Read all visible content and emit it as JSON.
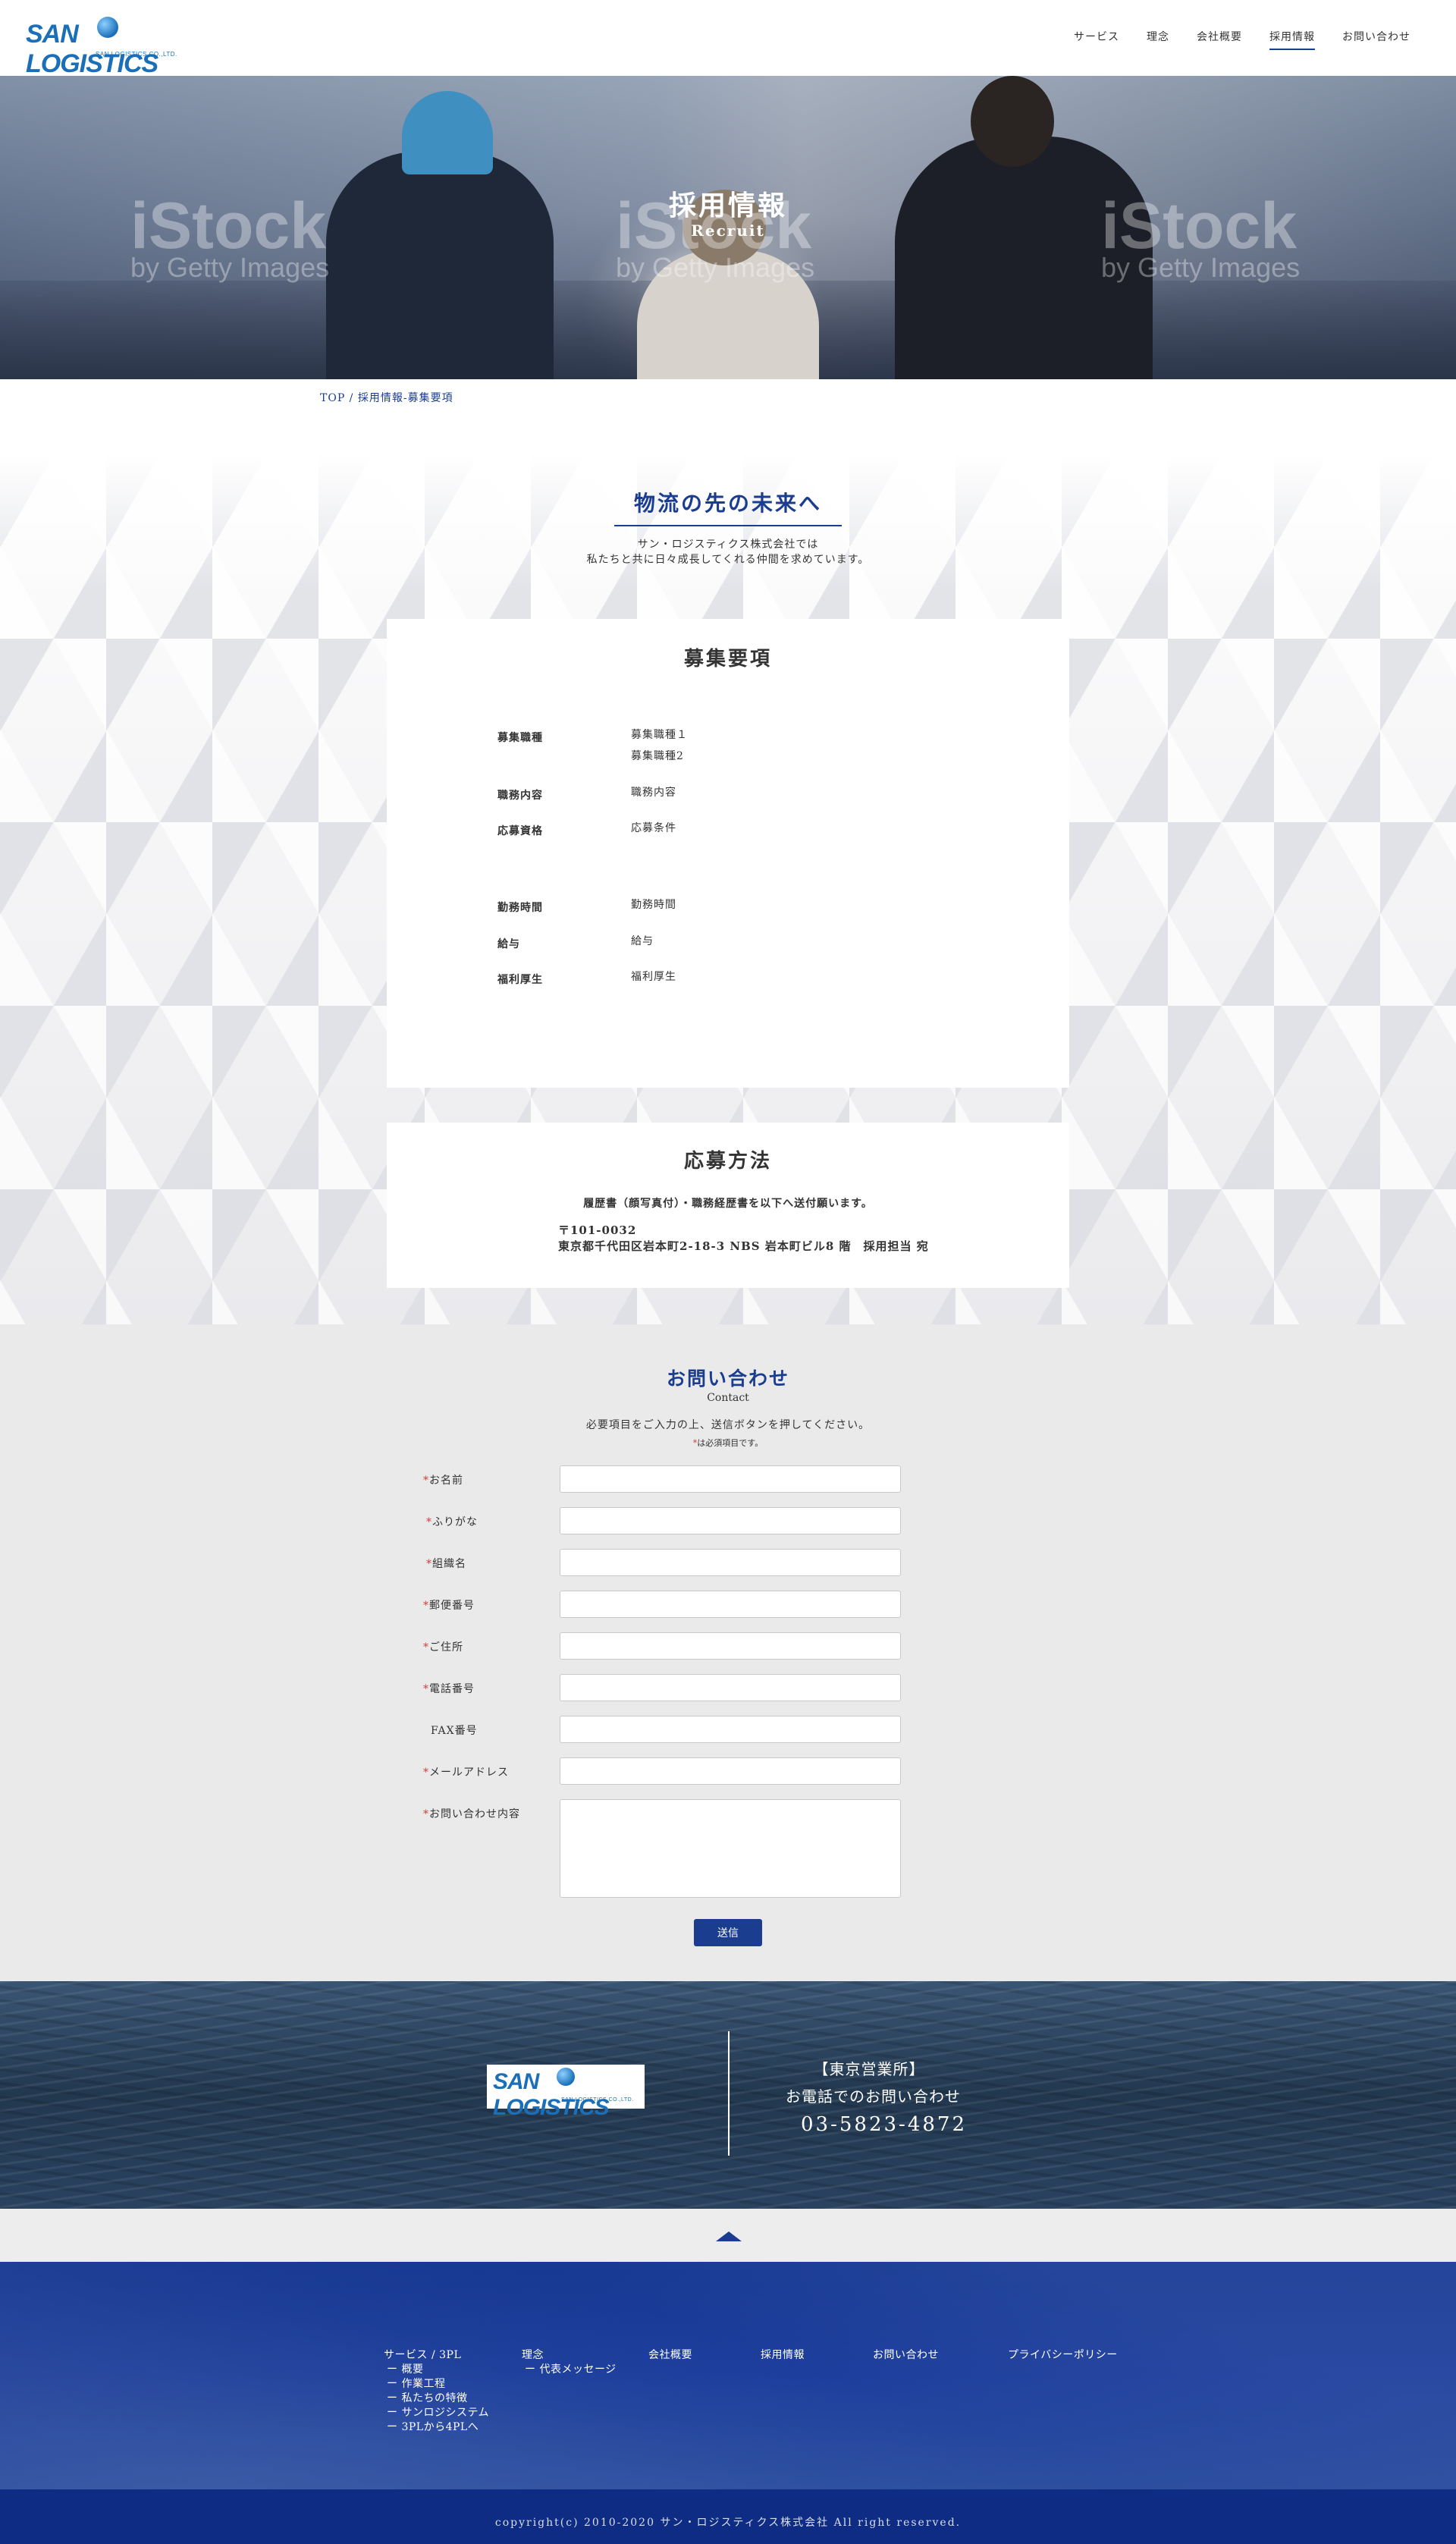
{
  "header": {
    "logo_text": "SAN LOGISTICS",
    "logo_sub": "SAN LOGISTICS CO.,LTD.",
    "nav": [
      {
        "label": "サービス"
      },
      {
        "label": "理念"
      },
      {
        "label": "会社概要"
      },
      {
        "label": "採用情報"
      },
      {
        "label": "お問い合わせ"
      }
    ]
  },
  "hero": {
    "title": "採用情報",
    "subtitle": "Recruit",
    "watermark_main": "iStock",
    "watermark_sub": "by Getty Images"
  },
  "breadcrumb": "TOP / 採用情報-募集要項",
  "lead": {
    "title": "物流の先の未来へ",
    "line1": "サン・ロジスティクス株式会社では",
    "line2": "私たちと共に日々成長してくれる仲間を求めています。"
  },
  "requirements": {
    "title": "募集要項",
    "rows": [
      {
        "label": "募集職種",
        "value": "募集職種１",
        "value2": "募集職種2"
      },
      {
        "label": "職務内容",
        "value": "職務内容"
      },
      {
        "label": "応募資格",
        "value": "応募条件"
      },
      {
        "label": "勤務時間",
        "value": "勤務時間"
      },
      {
        "label": "給与",
        "value": "給与"
      },
      {
        "label": "福利厚生",
        "value": "福利厚生"
      }
    ]
  },
  "application": {
    "title": "応募方法",
    "line1": "履歴書（顔写真付）・職務経歴書を以下へ送付願います。",
    "postal": "〒101-0032",
    "address": "東京都千代田区岩本町2-18-3 NBS 岩本町ビル8 階　採用担当 宛"
  },
  "contact": {
    "title": "お問い合わせ",
    "subtitle": "Contact",
    "note": "必要項目をご入力の上、送信ボタンを押してください。",
    "required_mark": "*",
    "required_note": "は必須項目です。",
    "fields": [
      {
        "label": "お名前",
        "required": true
      },
      {
        "label": "ふりがな",
        "required": true
      },
      {
        "label": "組織名",
        "required": true
      },
      {
        "label": "郵便番号",
        "required": true
      },
      {
        "label": "ご住所",
        "required": true
      },
      {
        "label": "電話番号",
        "required": true
      },
      {
        "label": "FAX番号",
        "required": false
      },
      {
        "label": "メールアドレス",
        "required": true
      },
      {
        "label": "お問い合わせ内容",
        "required": true
      }
    ],
    "submit_label": "送信"
  },
  "banner": {
    "office": "【東京営業所】",
    "phone_label": "お電話でのお問い合わせ",
    "phone": "03-5823-4872"
  },
  "footer": {
    "columns": [
      {
        "label": "サービス / 3PL",
        "subs": [
          "ー 概要",
          "ー 作業工程",
          "ー 私たちの特徴",
          "ー サンロジシステム",
          "ー 3PLから4PLへ"
        ]
      },
      {
        "label": "理念",
        "subs": [
          "ー 代表メッセージ"
        ]
      },
      {
        "label": "会社概要",
        "subs": []
      },
      {
        "label": "採用情報",
        "subs": []
      },
      {
        "label": "お問い合わせ",
        "subs": []
      },
      {
        "label": "プライバシーポリシー",
        "subs": []
      }
    ],
    "copyright": "copyright(c) 2010-2020 サン・ロジスティクス株式会社 All right reserved."
  },
  "colors": {
    "brand": "#1a3d8f",
    "logo": "#1a6fb8",
    "required": "#d23c3c"
  }
}
